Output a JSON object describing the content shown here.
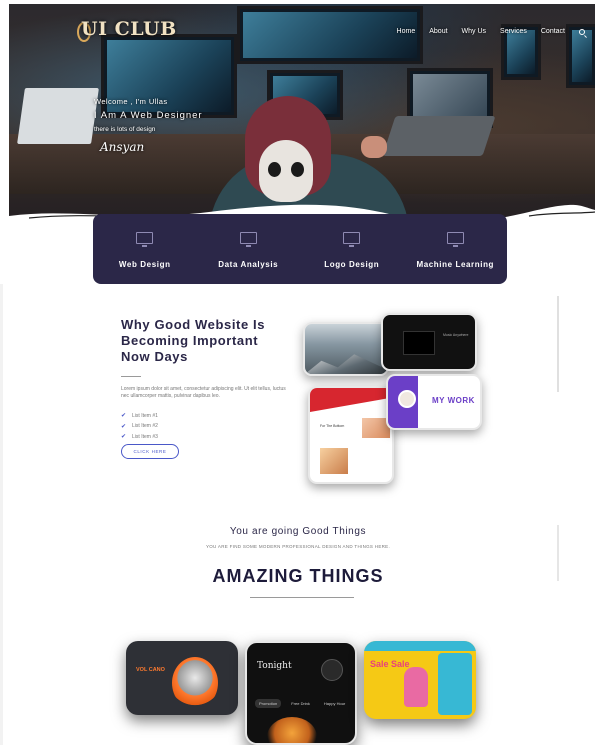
{
  "brand": {
    "logo_text": "UI CLUB"
  },
  "nav": {
    "items": [
      "Home",
      "About",
      "Why Us",
      "Services",
      "Contact"
    ],
    "search_icon": "search-icon"
  },
  "hero": {
    "welcome": "Welcome , I'm Ullas",
    "headline": "I Am A Web Designer",
    "tagline": "there is lots of design",
    "signature": "Ansyan"
  },
  "services": [
    {
      "icon": "monitor-icon",
      "label": "Web Design"
    },
    {
      "icon": "monitor-icon",
      "label": "Data Analysis"
    },
    {
      "icon": "monitor-icon",
      "label": "Logo Design"
    },
    {
      "icon": "monitor-icon",
      "label": "Machine Learning"
    }
  ],
  "why": {
    "title": "Why Good Website Is Becoming Important Now Days",
    "body": "Lorem ipsum dolor sit amet, consectetur adipiscing elit. Ut elit tellus, luctus nec ullamcorper mattis, pulvinar dapibus leo.",
    "list": [
      "List Item #1",
      "List Item #2",
      "List Item #3"
    ],
    "cta_label": "CLICK HERE"
  },
  "mockups": {
    "mock2_text": "Music Anywhere",
    "mock3_text": "For The Bottom",
    "mock4_text": "MY WORK"
  },
  "good": {
    "title": "You are going Good Things",
    "subtitle": "YOU ARE FIND SOME MODERN PROFESSIONAL DESIGN AND THINGS HERE."
  },
  "amazing": {
    "title": "AMAZING THINGS"
  },
  "cards": {
    "card1_text": "VOL CANO",
    "card2_title": "Tonight",
    "card2_tabs": [
      "Promotion",
      "Free Drink",
      "Happy Hour"
    ],
    "card3_text": "Sale Sale"
  },
  "colors": {
    "services_bg": "#2b2748",
    "accent": "#4a58c8",
    "heading": "#1d1b3a"
  }
}
